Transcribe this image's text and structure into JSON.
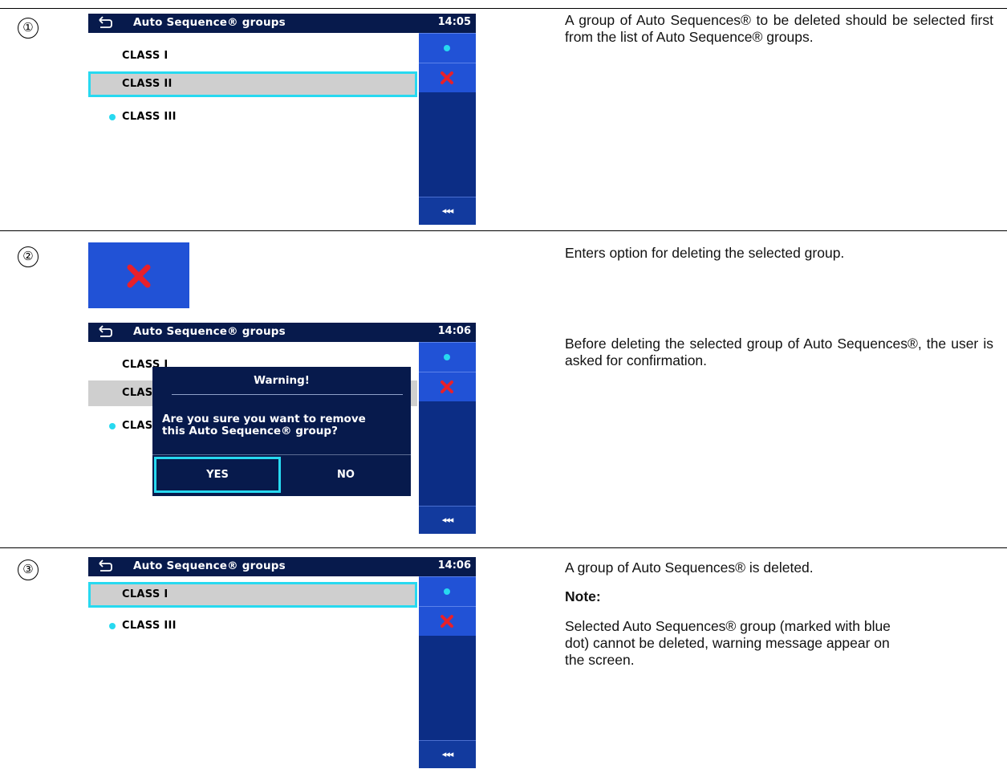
{
  "screen": {
    "title": "Auto Sequence® groups",
    "more_symbol": "◂◂◂"
  },
  "steps": [
    {
      "number": "①",
      "time": "14:05",
      "rows": [
        "CLASS I",
        "CLASS II",
        "CLASS III"
      ],
      "description": "A group of Auto Sequences® to be deleted should be selected first from the list of Auto Sequence® groups."
    },
    {
      "number": "②",
      "time": "14:06",
      "rows": [
        "CLASS I",
        "CLASS II",
        "CLASS III"
      ],
      "description_1": "Enters option for deleting the selected group.",
      "description_2": "Before deleting the selected group of Auto Sequences®, the user is asked for confirmation.",
      "dialog": {
        "title": "Warning!",
        "message_line1": "Are you sure you want to remove",
        "message_line2": "this Auto Sequence® group?",
        "yes": "YES",
        "no": "NO"
      }
    },
    {
      "number": "③",
      "time": "14:06",
      "rows": [
        "CLASS I",
        "CLASS III"
      ],
      "description_1": "A group of Auto Sequences® is deleted.",
      "note_label": "Note:",
      "description_2": "Selected Auto Sequences® group (marked with blue dot) cannot be deleted, warning message appear on the screen."
    }
  ],
  "colors": {
    "header": "#071a4c",
    "sidebar": "#0c2d85",
    "button": "#2152d6",
    "highlight": "#27d9f0",
    "delete": "#e8202a"
  }
}
